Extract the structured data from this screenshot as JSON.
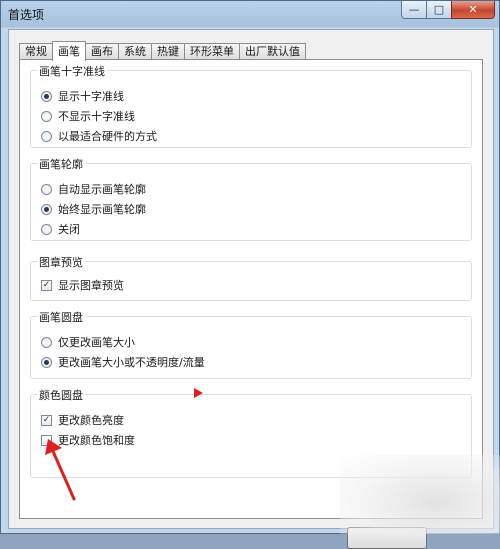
{
  "window": {
    "title": "首选项",
    "minimize_symbol": "—",
    "maximize_symbol": "□",
    "close_symbol": "✕"
  },
  "tabs": [
    {
      "label": "常规"
    },
    {
      "label": "画笔",
      "active": true
    },
    {
      "label": "画布"
    },
    {
      "label": "系统"
    },
    {
      "label": "热键"
    },
    {
      "label": "环形菜单"
    },
    {
      "label": "出厂默认值"
    }
  ],
  "groups": {
    "crosshair": {
      "title": "画笔十字准线",
      "options": [
        {
          "label": "显示十字准线",
          "checked": true
        },
        {
          "label": "不显示十字准线",
          "checked": false
        },
        {
          "label": "以最适合硬件的方式",
          "checked": false
        }
      ]
    },
    "outline": {
      "title": "画笔轮廓",
      "options": [
        {
          "label": "自动显示画笔轮廓",
          "checked": false
        },
        {
          "label": "始终显示画笔轮廓",
          "checked": true
        },
        {
          "label": "关闭",
          "checked": false
        }
      ]
    },
    "stamp_preview": {
      "title": "图章预览",
      "options": [
        {
          "label": "显示图章预览",
          "checked": true
        }
      ]
    },
    "brush_puck": {
      "title": "画笔圆盘",
      "options": [
        {
          "label": "仅更改画笔大小",
          "checked": false
        },
        {
          "label": "更改画笔大小或不透明度/流量",
          "checked": true
        }
      ]
    },
    "color_puck": {
      "title": "颜色圆盘",
      "options": [
        {
          "label": "更改颜色亮度",
          "checked": true
        },
        {
          "label": "更改颜色饱和度",
          "checked": false
        }
      ]
    }
  },
  "check_mark": "✓",
  "colors": {
    "annotation_red": "#e0201c",
    "titlebar": "#b9d1ea",
    "panel": "#ffffff"
  }
}
